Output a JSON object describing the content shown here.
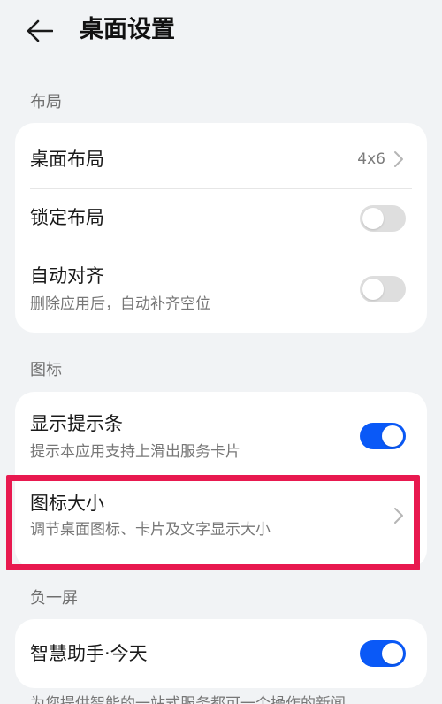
{
  "header": {
    "title": "桌面设置",
    "back_icon": "arrow-left-icon"
  },
  "sections": {
    "layout": {
      "label": "布局",
      "desktop_layout": {
        "title": "桌面布局",
        "value": "4x6"
      },
      "lock_layout": {
        "title": "锁定布局",
        "enabled": false
      },
      "auto_align": {
        "title": "自动对齐",
        "subtitle": "删除应用后，自动补齐空位",
        "enabled": false
      }
    },
    "icons": {
      "label": "图标",
      "show_hint_bar": {
        "title": "显示提示条",
        "subtitle": "提示本应用支持上滑出服务卡片",
        "enabled": true
      },
      "icon_size": {
        "title": "图标大小",
        "subtitle": "调节桌面图标、卡片及文字显示大小"
      }
    },
    "minus_one_screen": {
      "label": "负一屏",
      "smart_assistant": {
        "title": "智慧助手·今天",
        "enabled": true
      }
    }
  },
  "footer": {
    "text": "为您提供智能的一站式服务都可一个操作的新闻"
  },
  "colors": {
    "accent": "#0a59f7",
    "highlight": "#e8194f",
    "background": "#f1f3f5"
  }
}
